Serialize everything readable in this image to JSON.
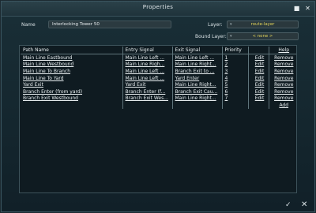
{
  "window": {
    "title": "Properties"
  },
  "form": {
    "name_label": "Name",
    "name_value": "Interlocking Tower 50",
    "layer_label": "Layer:",
    "layer_value": "route-layer",
    "bound_layer_label": "Bound Layer:",
    "bound_layer_value": "< none >"
  },
  "table": {
    "headers": {
      "path": "Path Name",
      "entry": "Entry Signal",
      "exit": "Exit Signal",
      "priority": "Priority",
      "help": "Help"
    },
    "rows": [
      {
        "path": "Main Line Eastbound",
        "entry": "Main Line Left ...",
        "exit": "Main Line Left ...",
        "priority": "1",
        "edit": "Edit",
        "remove": "Remove"
      },
      {
        "path": "Main Line Westbound",
        "entry": "Main Line Righ...",
        "exit": "Main Line Right...",
        "priority": "2",
        "edit": "Edit",
        "remove": "Remove"
      },
      {
        "path": "Main Line To Branch",
        "entry": "Main Line Left ...",
        "exit": "Branch Exit to ...",
        "priority": "3",
        "edit": "Edit",
        "remove": "Remove"
      },
      {
        "path": "Main Line To Yard",
        "entry": "Main Line Left ...",
        "exit": "Yard Enter",
        "priority": "4",
        "edit": "Edit",
        "remove": "Remove"
      },
      {
        "path": "Yard Exit",
        "entry": "Yard Exit",
        "exit": "Main Line Right...",
        "priority": "5",
        "edit": "Edit",
        "remove": "Remove"
      },
      {
        "path": "Branch Enter (from yard)",
        "entry": "Branch Enter (f...",
        "exit": "Branch Exit Cau...",
        "priority": "6",
        "edit": "Edit",
        "remove": "Remove"
      },
      {
        "path": "Branch Exit Westbound",
        "entry": "Branch Exit Wes...",
        "exit": "Main Line Right...",
        "priority": "7",
        "edit": "Edit",
        "remove": "Remove"
      }
    ],
    "add_label": "Add"
  },
  "footer": {
    "ok_glyph": "✓",
    "cancel_glyph": "✕"
  },
  "titlebar": {
    "maximize_glyph": "■",
    "close_glyph": "✕"
  }
}
